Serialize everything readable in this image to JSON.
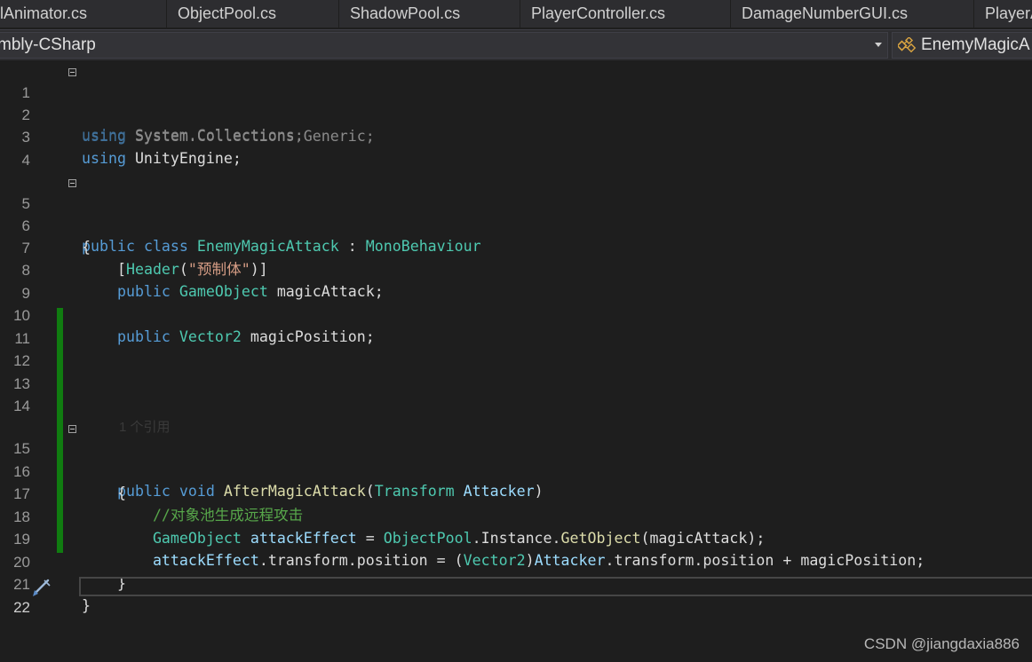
{
  "tabs": [
    {
      "label": "olAnimator.cs"
    },
    {
      "label": "ObjectPool.cs"
    },
    {
      "label": "ShadowPool.cs"
    },
    {
      "label": "PlayerController.cs"
    },
    {
      "label": "DamageNumberGUI.cs"
    },
    {
      "label": "PlayerA"
    }
  ],
  "navbar": {
    "project": "mbly-CSharp",
    "member": "EnemyMagicA",
    "member_icon": "class-member-icon"
  },
  "editor": {
    "lines": [
      {
        "n": "1"
      },
      {
        "n": "2"
      },
      {
        "n": "3"
      },
      {
        "n": "4"
      },
      {
        "n": "5"
      },
      {
        "n": "6"
      },
      {
        "n": "7"
      },
      {
        "n": "8"
      },
      {
        "n": "9"
      },
      {
        "n": "10"
      },
      {
        "n": "11"
      },
      {
        "n": "12"
      },
      {
        "n": "13"
      },
      {
        "n": "14"
      },
      {
        "n": "15"
      },
      {
        "n": "16"
      },
      {
        "n": "17"
      },
      {
        "n": "18"
      },
      {
        "n": "19"
      },
      {
        "n": "20"
      },
      {
        "n": "21"
      },
      {
        "n": "22"
      }
    ],
    "codelens": "1 个引用",
    "tokens": {
      "using": "using",
      "ns1": " System.Collections;",
      "ns2": " System.Collections.Generic;",
      "ns3": " UnityEngine;",
      "public": "public",
      "class": "class",
      "classname": "EnemyMagicAttack",
      "colon": " : ",
      "base": "MonoBehaviour",
      "open": "{",
      "close": "}",
      "attr_open": "[",
      "header": "Header",
      "paren_open": "(",
      "header_str": "\"预制体\"",
      "attr_close": ")]",
      "gameobject": "GameObject",
      "field1": " magicAttack;",
      "vector2": "Vector2",
      "field2": " magicPosition;",
      "void": "void",
      "method": "AfterMagicAttack",
      "transform": "Transform",
      "attacker": "Attacker",
      "paren_close": ")",
      "comment": "//对象池生成远程攻击",
      "attackEffect": "attackEffect",
      "eq": " = ",
      "objectpool": "ObjectPool",
      "instance": ".Instance.",
      "getobject": "GetObject",
      "arg": "(magicAttack);",
      "tpos": ".transform.position",
      "cast_open": "(",
      "cast_close": ")",
      "plus": " + ",
      "magicPosition": "magicPosition;"
    }
  },
  "watermark": "CSDN @jiangdaxia886",
  "colors": {
    "background": "#1e1e1e",
    "keyword": "#569cd6",
    "type": "#4ec9b0",
    "string": "#d69d85",
    "comment": "#57a64a",
    "method": "#dcdcaa",
    "parameter": "#9cdcfe",
    "change_bar": "#107c10"
  }
}
